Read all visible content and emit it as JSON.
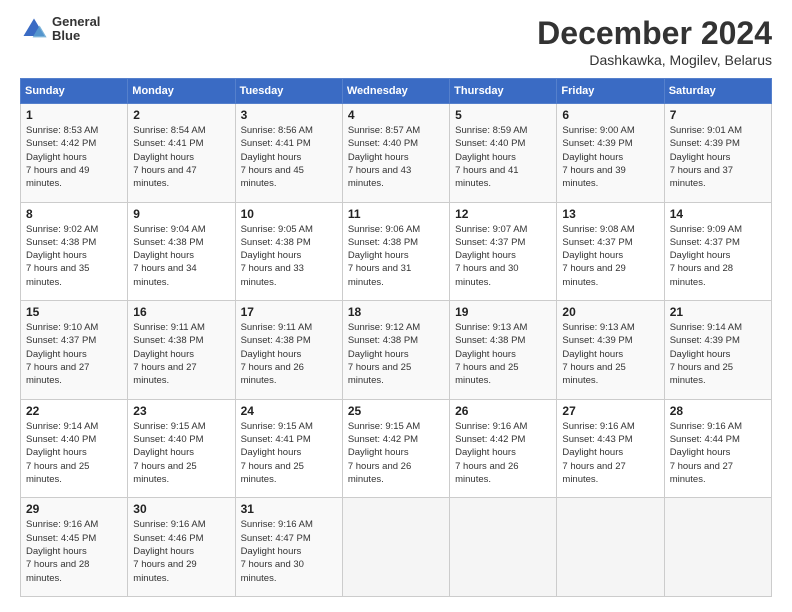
{
  "header": {
    "logo_line1": "General",
    "logo_line2": "Blue",
    "month_title": "December 2024",
    "subtitle": "Dashkawka, Mogilev, Belarus"
  },
  "calendar": {
    "days": [
      "Sunday",
      "Monday",
      "Tuesday",
      "Wednesday",
      "Thursday",
      "Friday",
      "Saturday"
    ],
    "weeks": [
      [
        {
          "date": "1",
          "sunrise": "8:53 AM",
          "sunset": "4:42 PM",
          "daylight": "7 hours and 49 minutes."
        },
        {
          "date": "2",
          "sunrise": "8:54 AM",
          "sunset": "4:41 PM",
          "daylight": "7 hours and 47 minutes."
        },
        {
          "date": "3",
          "sunrise": "8:56 AM",
          "sunset": "4:41 PM",
          "daylight": "7 hours and 45 minutes."
        },
        {
          "date": "4",
          "sunrise": "8:57 AM",
          "sunset": "4:40 PM",
          "daylight": "7 hours and 43 minutes."
        },
        {
          "date": "5",
          "sunrise": "8:59 AM",
          "sunset": "4:40 PM",
          "daylight": "7 hours and 41 minutes."
        },
        {
          "date": "6",
          "sunrise": "9:00 AM",
          "sunset": "4:39 PM",
          "daylight": "7 hours and 39 minutes."
        },
        {
          "date": "7",
          "sunrise": "9:01 AM",
          "sunset": "4:39 PM",
          "daylight": "7 hours and 37 minutes."
        }
      ],
      [
        {
          "date": "8",
          "sunrise": "9:02 AM",
          "sunset": "4:38 PM",
          "daylight": "7 hours and 35 minutes."
        },
        {
          "date": "9",
          "sunrise": "9:04 AM",
          "sunset": "4:38 PM",
          "daylight": "7 hours and 34 minutes."
        },
        {
          "date": "10",
          "sunrise": "9:05 AM",
          "sunset": "4:38 PM",
          "daylight": "7 hours and 33 minutes."
        },
        {
          "date": "11",
          "sunrise": "9:06 AM",
          "sunset": "4:38 PM",
          "daylight": "7 hours and 31 minutes."
        },
        {
          "date": "12",
          "sunrise": "9:07 AM",
          "sunset": "4:37 PM",
          "daylight": "7 hours and 30 minutes."
        },
        {
          "date": "13",
          "sunrise": "9:08 AM",
          "sunset": "4:37 PM",
          "daylight": "7 hours and 29 minutes."
        },
        {
          "date": "14",
          "sunrise": "9:09 AM",
          "sunset": "4:37 PM",
          "daylight": "7 hours and 28 minutes."
        }
      ],
      [
        {
          "date": "15",
          "sunrise": "9:10 AM",
          "sunset": "4:37 PM",
          "daylight": "7 hours and 27 minutes."
        },
        {
          "date": "16",
          "sunrise": "9:11 AM",
          "sunset": "4:38 PM",
          "daylight": "7 hours and 27 minutes."
        },
        {
          "date": "17",
          "sunrise": "9:11 AM",
          "sunset": "4:38 PM",
          "daylight": "7 hours and 26 minutes."
        },
        {
          "date": "18",
          "sunrise": "9:12 AM",
          "sunset": "4:38 PM",
          "daylight": "7 hours and 25 minutes."
        },
        {
          "date": "19",
          "sunrise": "9:13 AM",
          "sunset": "4:38 PM",
          "daylight": "7 hours and 25 minutes."
        },
        {
          "date": "20",
          "sunrise": "9:13 AM",
          "sunset": "4:39 PM",
          "daylight": "7 hours and 25 minutes."
        },
        {
          "date": "21",
          "sunrise": "9:14 AM",
          "sunset": "4:39 PM",
          "daylight": "7 hours and 25 minutes."
        }
      ],
      [
        {
          "date": "22",
          "sunrise": "9:14 AM",
          "sunset": "4:40 PM",
          "daylight": "7 hours and 25 minutes."
        },
        {
          "date": "23",
          "sunrise": "9:15 AM",
          "sunset": "4:40 PM",
          "daylight": "7 hours and 25 minutes."
        },
        {
          "date": "24",
          "sunrise": "9:15 AM",
          "sunset": "4:41 PM",
          "daylight": "7 hours and 25 minutes."
        },
        {
          "date": "25",
          "sunrise": "9:15 AM",
          "sunset": "4:42 PM",
          "daylight": "7 hours and 26 minutes."
        },
        {
          "date": "26",
          "sunrise": "9:16 AM",
          "sunset": "4:42 PM",
          "daylight": "7 hours and 26 minutes."
        },
        {
          "date": "27",
          "sunrise": "9:16 AM",
          "sunset": "4:43 PM",
          "daylight": "7 hours and 27 minutes."
        },
        {
          "date": "28",
          "sunrise": "9:16 AM",
          "sunset": "4:44 PM",
          "daylight": "7 hours and 27 minutes."
        }
      ],
      [
        {
          "date": "29",
          "sunrise": "9:16 AM",
          "sunset": "4:45 PM",
          "daylight": "7 hours and 28 minutes."
        },
        {
          "date": "30",
          "sunrise": "9:16 AM",
          "sunset": "4:46 PM",
          "daylight": "7 hours and 29 minutes."
        },
        {
          "date": "31",
          "sunrise": "9:16 AM",
          "sunset": "4:47 PM",
          "daylight": "7 hours and 30 minutes."
        },
        null,
        null,
        null,
        null
      ]
    ]
  }
}
